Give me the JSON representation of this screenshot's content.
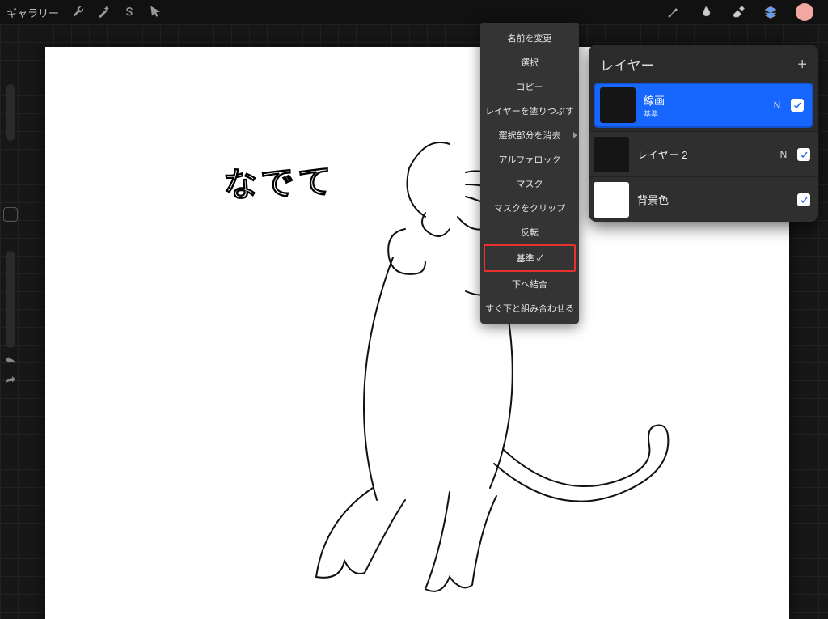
{
  "toolbar": {
    "gallery_label": "ギャラリー"
  },
  "canvas_text": "なでて",
  "context_menu": {
    "items": [
      {
        "label": "名前を変更"
      },
      {
        "label": "選択"
      },
      {
        "label": "コピー"
      },
      {
        "label": "レイヤーを塗りつぶす"
      },
      {
        "label": "選択部分を消去",
        "has_sub": true
      },
      {
        "label": "アルファロック"
      },
      {
        "label": "マスク"
      },
      {
        "label": "マスクをクリップ"
      },
      {
        "label": "反転"
      },
      {
        "label": "基準 ✓",
        "highlighted": true
      },
      {
        "label": "下へ結合"
      },
      {
        "label": "すぐ下と組み合わせる"
      }
    ]
  },
  "layers_panel": {
    "title": "レイヤー",
    "layers": [
      {
        "name": "線画",
        "sub": "基準",
        "blend": "N",
        "selected": true,
        "thumb": "dark"
      },
      {
        "name": "レイヤー 2",
        "sub": "",
        "blend": "N",
        "selected": false,
        "thumb": "dark"
      },
      {
        "name": "背景色",
        "sub": "",
        "blend": "",
        "selected": false,
        "thumb": "white"
      }
    ]
  },
  "colors": {
    "accent": "#1767ff",
    "swatch": "#f2a8a0",
    "highlight_border": "#e8322f"
  }
}
